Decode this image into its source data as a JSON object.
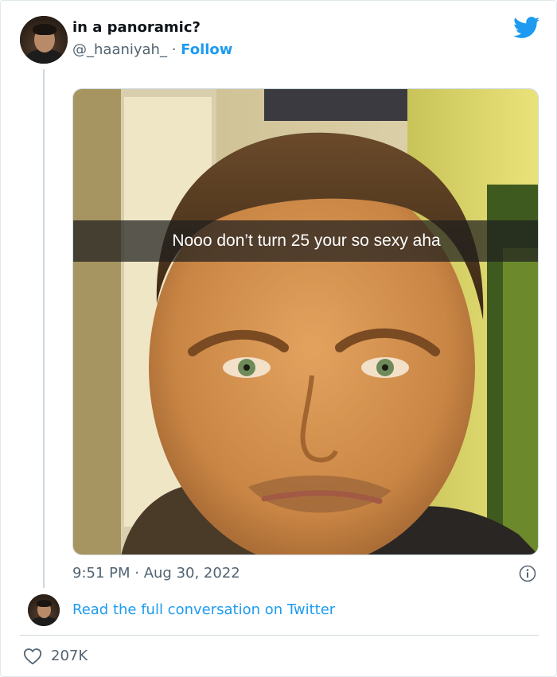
{
  "tweet": {
    "display_name": "in a panoramic?",
    "handle": "@_haaniyah_",
    "separator": " · ",
    "follow_label": "Follow",
    "image_caption": "Nooo don’t turn 25 your so sexy aha",
    "time": "9:51 PM",
    "date_separator": " · ",
    "date": "Aug 30, 2022",
    "read_more_label": "Read the full conversation on Twitter",
    "like_count": "207K"
  },
  "colors": {
    "accent": "#1d9bf0",
    "secondary_text": "#536471",
    "primary_text": "#0f1419",
    "border": "#cfd9de"
  },
  "icons": {
    "brand": "twitter-bird-icon",
    "info": "info-icon",
    "like": "heart-icon"
  }
}
